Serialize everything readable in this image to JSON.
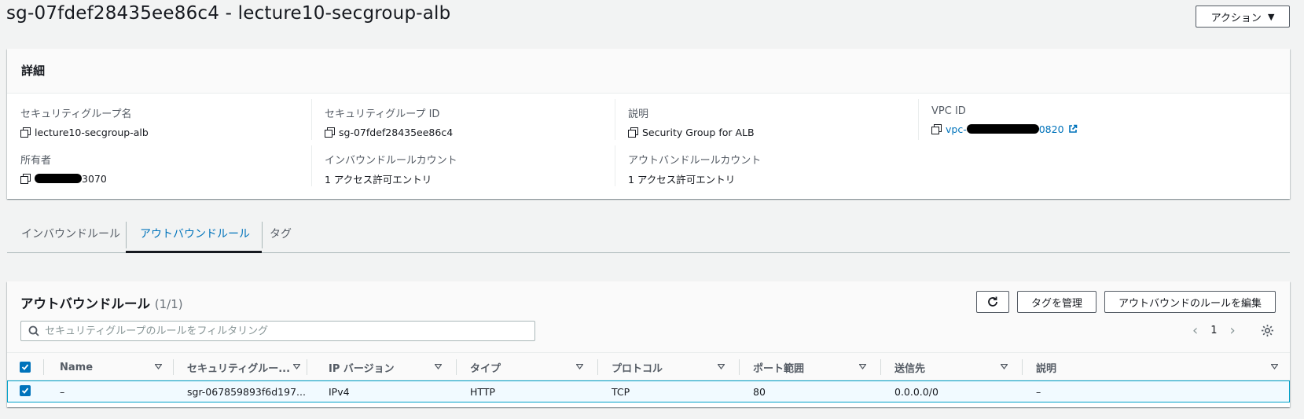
{
  "page": {
    "title": "sg-07fdef28435ee86c4 - lecture10-secgroup-alb",
    "action_label": "アクション"
  },
  "details": {
    "heading": "詳細",
    "group_name_label": "セキュリティグループ名",
    "group_name": "lecture10-secgroup-alb",
    "group_id_label": "セキュリティグループ ID",
    "group_id": "sg-07fdef28435ee86c4",
    "description_label": "説明",
    "description": "Security Group for ALB",
    "vpc_id_label": "VPC ID",
    "vpc_id_prefix": "vpc-",
    "vpc_id_suffix": "0820",
    "owner_label": "所有者",
    "owner_suffix": "3070",
    "inbound_count_label": "インバウンドルールカウント",
    "inbound_count": "1 アクセス許可エントリ",
    "outbound_count_label": "アウトバンドルールカウント",
    "outbound_count": "1 アクセス許可エントリ"
  },
  "tabs": [
    {
      "label": "インバウンドルール",
      "active": false
    },
    {
      "label": "アウトバウンドルール",
      "active": true
    },
    {
      "label": "タグ",
      "active": false
    }
  ],
  "rules": {
    "title": "アウトバウンドルール",
    "count": "(1/1)",
    "manage_tags_label": "タグを管理",
    "edit_rules_label": "アウトバウンドのルールを編集",
    "search_placeholder": "セキュリティグループのルールをフィルタリング",
    "page_number": "1",
    "columns": [
      "Name",
      "セキュリティグルー...",
      "IP バージョン",
      "タイプ",
      "プロトコル",
      "ポート範囲",
      "送信先",
      "説明"
    ],
    "row": {
      "name": "–",
      "rule_id": "sgr-067859893f6d197...",
      "ip_version": "IPv4",
      "type": "HTTP",
      "protocol": "TCP",
      "port_range": "80",
      "destination": "0.0.0.0/0",
      "description": "–"
    }
  },
  "colors": {
    "link": "#0073bb",
    "selected_border": "#00a1c9",
    "selected_bg": "#f1faff",
    "checkbox": "#0073bb"
  },
  "icons": [
    "copy-icon",
    "external-link-icon",
    "refresh-icon",
    "search-icon",
    "chevron-left-icon",
    "chevron-right-icon",
    "settings-icon",
    "sort-icon",
    "checkbox-checked-icon",
    "caret-down-icon"
  ]
}
